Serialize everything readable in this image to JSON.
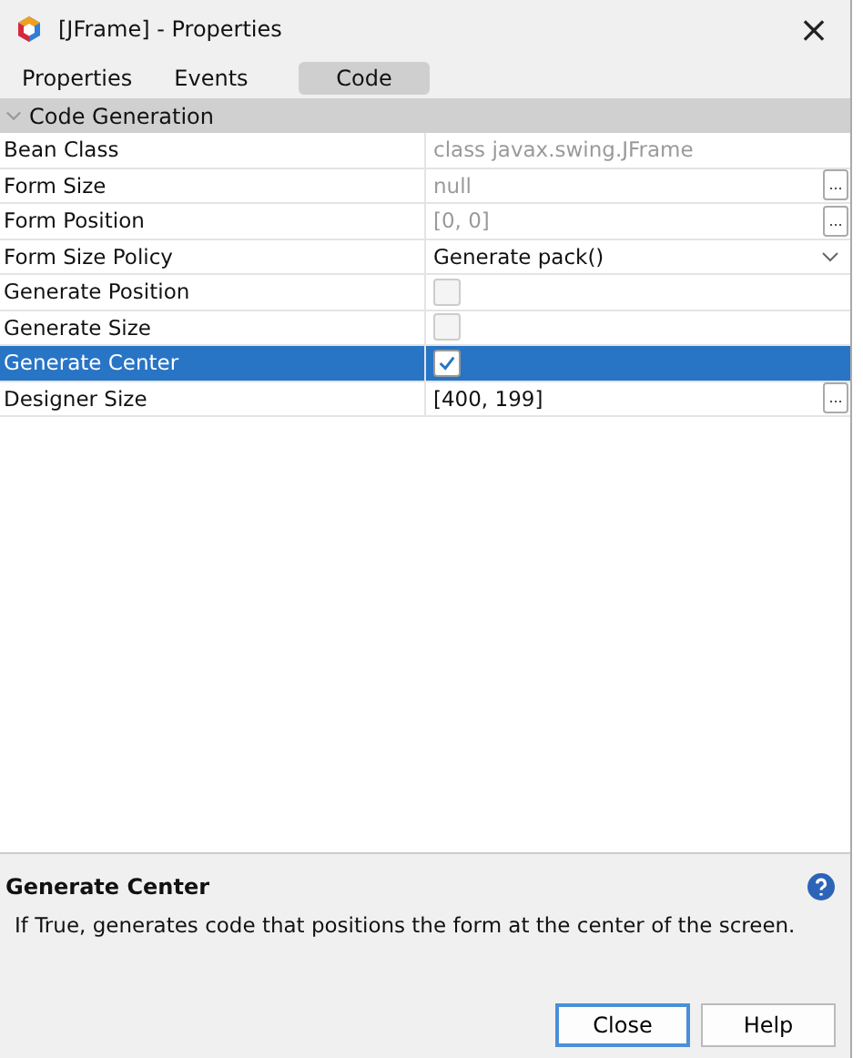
{
  "window": {
    "title": "[JFrame] - Properties",
    "close": "×"
  },
  "tabs": [
    {
      "label": "Properties",
      "selected": false
    },
    {
      "label": "Events",
      "selected": false
    },
    {
      "label": "Code",
      "selected": true
    }
  ],
  "section": {
    "title": "Code Generation",
    "expanded": true
  },
  "rows": [
    {
      "name": "Bean Class",
      "kind": "text",
      "value": "class javax.swing.JFrame",
      "disabled": true,
      "button": "",
      "selected": false
    },
    {
      "name": "Form Size",
      "kind": "text",
      "value": "null",
      "disabled": true,
      "button": "...",
      "selected": false
    },
    {
      "name": "Form Position",
      "kind": "text",
      "value": "[0, 0]",
      "disabled": true,
      "button": "...",
      "selected": false
    },
    {
      "name": "Form Size Policy",
      "kind": "combo",
      "value": "Generate pack()",
      "disabled": false,
      "selected": false
    },
    {
      "name": "Generate Position",
      "kind": "checkbox",
      "checked": false,
      "disabled": true,
      "selected": false
    },
    {
      "name": "Generate Size",
      "kind": "checkbox",
      "checked": false,
      "disabled": true,
      "selected": false
    },
    {
      "name": "Generate Center",
      "kind": "checkbox",
      "checked": true,
      "disabled": false,
      "selected": true
    },
    {
      "name": "Designer Size",
      "kind": "text",
      "value": "[400, 199]",
      "disabled": false,
      "button": "...",
      "selected": false
    }
  ],
  "description": {
    "title": "Generate Center",
    "text": "If True, generates code that positions the form at the center of the screen."
  },
  "buttons": [
    {
      "label": "Close",
      "default": true
    },
    {
      "label": "Help",
      "default": false
    }
  ]
}
